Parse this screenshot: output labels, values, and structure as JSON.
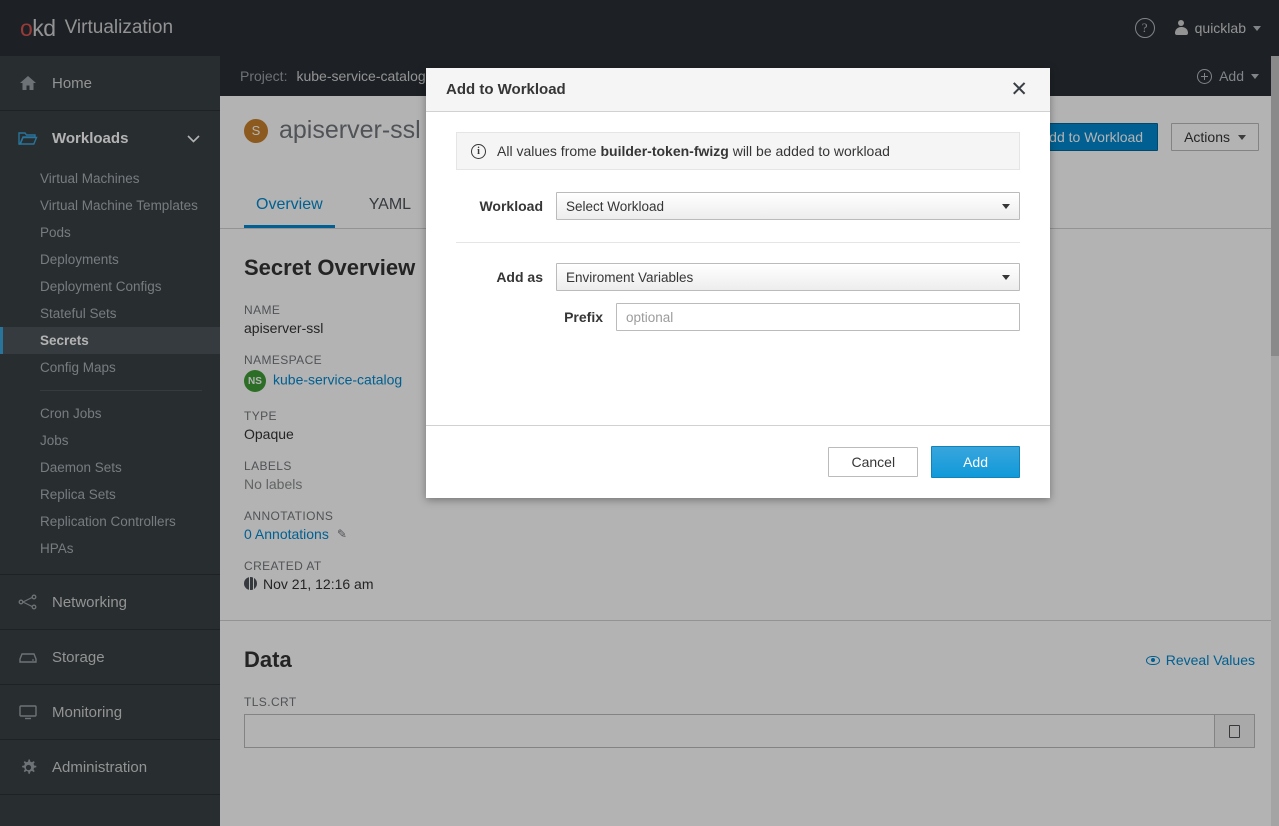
{
  "masthead": {
    "logo_primary": "okd",
    "logo_secondary": "Virtualization",
    "help_icon": "help-circle-icon",
    "user_name": "quicklab"
  },
  "sidebar": {
    "sections": [
      {
        "label": "Home",
        "icon": "home-icon",
        "expanded": false,
        "children": []
      },
      {
        "label": "Workloads",
        "icon": "folder-open-icon",
        "expanded": true,
        "children": [
          {
            "label": "Virtual Machines",
            "active": false
          },
          {
            "label": "Virtual Machine Templates",
            "active": false
          },
          {
            "label": "Pods",
            "active": false
          },
          {
            "label": "Deployments",
            "active": false
          },
          {
            "label": "Deployment Configs",
            "active": false
          },
          {
            "label": "Stateful Sets",
            "active": false
          },
          {
            "label": "Secrets",
            "active": true
          },
          {
            "label": "Config Maps",
            "active": false
          },
          {
            "divider": true
          },
          {
            "label": "Cron Jobs",
            "active": false
          },
          {
            "label": "Jobs",
            "active": false
          },
          {
            "label": "Daemon Sets",
            "active": false
          },
          {
            "label": "Replica Sets",
            "active": false
          },
          {
            "label": "Replication Controllers",
            "active": false
          },
          {
            "label": "HPAs",
            "active": false
          }
        ]
      },
      {
        "label": "Networking",
        "icon": "network-icon",
        "expanded": false,
        "children": []
      },
      {
        "label": "Storage",
        "icon": "storage-icon",
        "expanded": false,
        "children": []
      },
      {
        "label": "Monitoring",
        "icon": "monitor-icon",
        "expanded": false,
        "children": []
      },
      {
        "label": "Administration",
        "icon": "gear-icon",
        "expanded": false,
        "children": []
      }
    ]
  },
  "project_bar": {
    "label": "Project:",
    "project_name": "kube-service-catalog",
    "add_label": "Add"
  },
  "resource_header": {
    "badge_letter": "S",
    "name": "apiserver-ssl",
    "add_to_workload_label": "Add to Workload",
    "actions_label": "Actions"
  },
  "tabs": [
    {
      "label": "Overview",
      "active": true
    },
    {
      "label": "YAML",
      "active": false
    }
  ],
  "overview": {
    "section_title": "Secret Overview",
    "fields": [
      {
        "term": "NAME",
        "value": "apiserver-ssl",
        "kind": "text"
      },
      {
        "term": "NAMESPACE",
        "value": "kube-service-catalog",
        "kind": "namespace",
        "badge": "NS"
      },
      {
        "term": "TYPE",
        "value": "Opaque",
        "kind": "text"
      },
      {
        "term": "LABELS",
        "value": "No labels",
        "kind": "muted"
      },
      {
        "term": "ANNOTATIONS",
        "value": "0 Annotations",
        "kind": "link-edit"
      },
      {
        "term": "CREATED AT",
        "value": "Nov 21, 12:16 am",
        "kind": "timestamp"
      }
    ]
  },
  "data_section": {
    "title": "Data",
    "reveal_label": "Reveal Values",
    "keys": [
      "TLS.CRT"
    ]
  },
  "modal": {
    "title": "Add to Workload",
    "close_icon": "close-icon",
    "alert": {
      "icon": "info-circle-icon",
      "prefix_text": "All values frome ",
      "bold_text": "builder-token-fwizg",
      "suffix_text": " will be added to workload"
    },
    "fields": {
      "workload_label": "Workload",
      "workload_value": "Select Workload",
      "add_as_label": "Add as",
      "add_as_value": "Enviroment Variables",
      "prefix_label": "Prefix",
      "prefix_value": "",
      "prefix_placeholder": "optional"
    },
    "footer": {
      "cancel_label": "Cancel",
      "add_label": "Add"
    }
  },
  "colors": {
    "masthead_bg": "#292e34",
    "sidebar_bg": "#393f44",
    "accent_blue": "#0088ce",
    "primary_button": "#0f9ada",
    "active_nav": "#39a5dc",
    "secret_badge": "#c8802a",
    "namespace_badge": "#3f9c35"
  }
}
